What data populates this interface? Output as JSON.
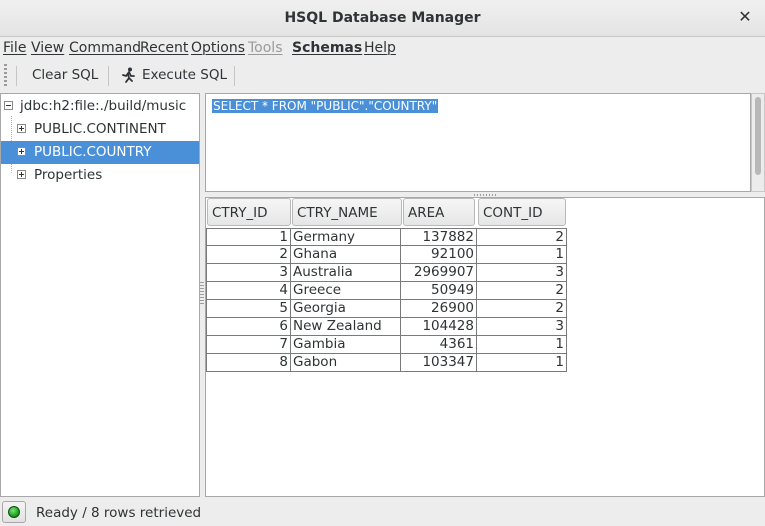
{
  "window": {
    "title": "HSQL Database Manager",
    "close_glyph": "✕"
  },
  "menu": [
    {
      "label": "File",
      "disabled": false
    },
    {
      "label": "View",
      "disabled": false
    },
    {
      "label": "Command",
      "disabled": false
    },
    {
      "label": "Recent",
      "disabled": false
    },
    {
      "label": "Options",
      "disabled": false
    },
    {
      "label": "Tools",
      "disabled": true
    },
    {
      "label": "Schemas",
      "disabled": false
    },
    {
      "label": "Help",
      "disabled": false
    }
  ],
  "toolbar": {
    "clear_label": "Clear SQL",
    "execute_label": "Execute SQL",
    "execute_icon": "runner-icon"
  },
  "tree": {
    "root": "jdbc:h2:file:./build/music",
    "items": [
      "PUBLIC.CONTINENT",
      "PUBLIC.COUNTRY",
      "Properties"
    ],
    "selected": "PUBLIC.COUNTRY"
  },
  "sql": {
    "text": "SELECT * FROM \"PUBLIC\".\"COUNTRY\""
  },
  "results": {
    "columns": [
      "CTRY_ID",
      "CTRY_NAME",
      "AREA",
      "CONT_ID"
    ],
    "rows": [
      [
        "1",
        "Germany",
        "137882",
        "2"
      ],
      [
        "2",
        "Ghana",
        "92100",
        "1"
      ],
      [
        "3",
        "Australia",
        "2969907",
        "3"
      ],
      [
        "4",
        "Greece",
        "50949",
        "2"
      ],
      [
        "5",
        "Georgia",
        "26900",
        "2"
      ],
      [
        "6",
        "New Zealand",
        "104428",
        "3"
      ],
      [
        "7",
        "Gambia",
        "4361",
        "1"
      ],
      [
        "8",
        "Gabon",
        "103347",
        "1"
      ]
    ]
  },
  "status": {
    "text": "Ready / 8 rows retrieved",
    "icon": "status-ok-icon",
    "color": "#1ea31e"
  },
  "colors": {
    "selection": "#4a90d9"
  }
}
